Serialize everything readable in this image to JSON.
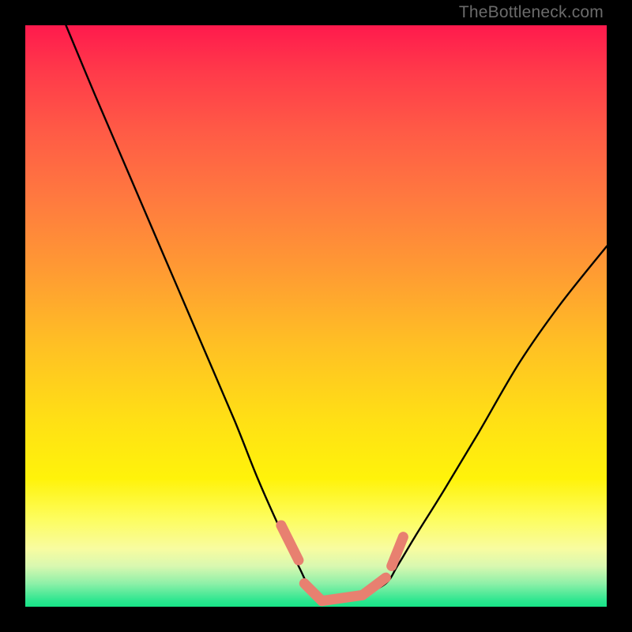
{
  "watermark": "TheBottleneck.com",
  "chart_data": {
    "type": "line",
    "title": "",
    "xlabel": "",
    "ylabel": "",
    "xlim": [
      0,
      100
    ],
    "ylim": [
      0,
      100
    ],
    "background_gradient": {
      "top_color": "#ff1a4d",
      "mid_color": "#ffe015",
      "bottom_color": "#17e387"
    },
    "series": [
      {
        "name": "bottleneck-curve",
        "color": "#000000",
        "x": [
          7,
          12,
          18,
          24,
          30,
          36,
          40,
          44,
          47,
          49,
          51,
          54,
          58,
          62,
          64,
          67,
          72,
          78,
          85,
          92,
          100
        ],
        "y": [
          100,
          88,
          74,
          60,
          46,
          32,
          22,
          13,
          7,
          3,
          1,
          1,
          2,
          4,
          7,
          12,
          20,
          30,
          42,
          52,
          62
        ]
      },
      {
        "name": "highlight-segments",
        "color": "#e88070",
        "note": "thicker salmon segments near trough",
        "segments": [
          {
            "x": [
              44,
              47
            ],
            "y": [
              14,
              8
            ]
          },
          {
            "x": [
              48,
              51
            ],
            "y": [
              4,
              1
            ]
          },
          {
            "x": [
              51,
              58
            ],
            "y": [
              1,
              2
            ]
          },
          {
            "x": [
              58,
              62
            ],
            "y": [
              2,
              5
            ]
          },
          {
            "x": [
              63,
              65
            ],
            "y": [
              7,
              12
            ]
          }
        ]
      }
    ]
  }
}
